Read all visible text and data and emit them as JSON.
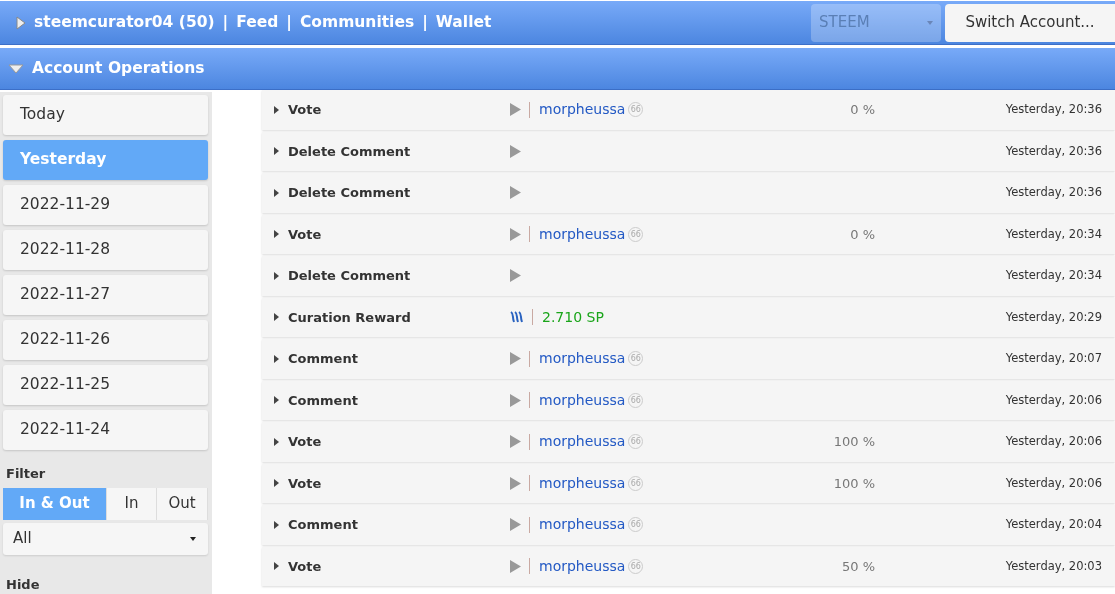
{
  "header": {
    "account": "steemcurator04 (50)",
    "links": [
      "Feed",
      "Communities",
      "Wallet"
    ],
    "separator": "|",
    "currency": "STEEM",
    "switch_button": "Switch Account..."
  },
  "section": {
    "title": "Account Operations",
    "expanded": true
  },
  "dates": [
    {
      "label": "Today",
      "selected": false
    },
    {
      "label": "Yesterday",
      "selected": true
    },
    {
      "label": "2022-11-29",
      "selected": false
    },
    {
      "label": "2022-11-28",
      "selected": false
    },
    {
      "label": "2022-11-27",
      "selected": false
    },
    {
      "label": "2022-11-26",
      "selected": false
    },
    {
      "label": "2022-11-25",
      "selected": false
    },
    {
      "label": "2022-11-24",
      "selected": false
    }
  ],
  "filter": {
    "label": "Filter",
    "options": [
      {
        "label": "In & Out",
        "selected": true
      },
      {
        "label": "In",
        "selected": false
      },
      {
        "label": "Out",
        "selected": false
      }
    ],
    "type_select": "All"
  },
  "hide": {
    "label": "Hide"
  },
  "operations": [
    {
      "kind": "account",
      "op": "Vote",
      "account": "morpheussa",
      "reputation": "66",
      "percent": "0 %",
      "time": "Yesterday, 20:36"
    },
    {
      "kind": "plain",
      "op": "Delete Comment",
      "time": "Yesterday, 20:36"
    },
    {
      "kind": "plain",
      "op": "Delete Comment",
      "time": "Yesterday, 20:36"
    },
    {
      "kind": "account",
      "op": "Vote",
      "account": "morpheussa",
      "reputation": "66",
      "percent": "0 %",
      "time": "Yesterday, 20:34"
    },
    {
      "kind": "plain",
      "op": "Delete Comment",
      "time": "Yesterday, 20:34"
    },
    {
      "kind": "reward",
      "op": "Curation Reward",
      "amount": "2.710 SP",
      "time": "Yesterday, 20:29"
    },
    {
      "kind": "account",
      "op": "Comment",
      "account": "morpheussa",
      "reputation": "66",
      "time": "Yesterday, 20:07"
    },
    {
      "kind": "account",
      "op": "Comment",
      "account": "morpheussa",
      "reputation": "66",
      "time": "Yesterday, 20:06"
    },
    {
      "kind": "account",
      "op": "Vote",
      "account": "morpheussa",
      "reputation": "66",
      "percent": "100 %",
      "time": "Yesterday, 20:06"
    },
    {
      "kind": "account",
      "op": "Vote",
      "account": "morpheussa",
      "reputation": "66",
      "percent": "100 %",
      "time": "Yesterday, 20:06"
    },
    {
      "kind": "account",
      "op": "Comment",
      "account": "morpheussa",
      "reputation": "66",
      "time": "Yesterday, 20:04"
    },
    {
      "kind": "account",
      "op": "Vote",
      "account": "morpheussa",
      "reputation": "66",
      "percent": "50 %",
      "time": "Yesterday, 20:03"
    }
  ]
}
